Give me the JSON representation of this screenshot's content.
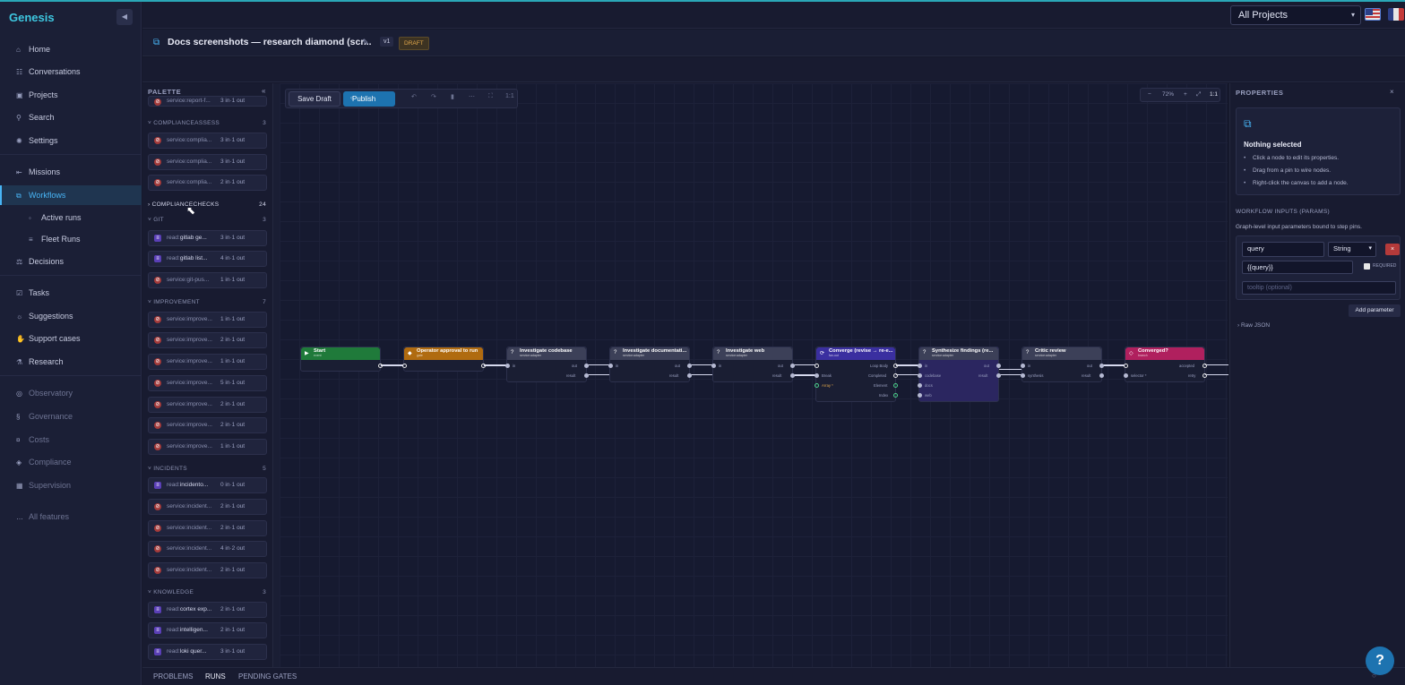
{
  "app": {
    "brand": "Genesis",
    "collapse_icon": "◀"
  },
  "nav": {
    "home": "Home",
    "conversations": "Conversations",
    "projects": "Projects",
    "search": "Search",
    "settings": "Settings",
    "missions": "Missions",
    "workflows": "Workflows",
    "active_runs": "Active runs",
    "fleet_runs": "Fleet Runs",
    "decisions": "Decisions",
    "tasks": "Tasks",
    "suggestions": "Suggestions",
    "support_cases": "Support cases",
    "research": "Research",
    "observatory": "Observatory",
    "governance": "Governance",
    "costs": "Costs",
    "compliance": "Compliance",
    "supervision": "Supervision",
    "all_features": "All features"
  },
  "header": {
    "project_select": "All Projects",
    "doc_title": "Docs screenshots — research diamond (scr...",
    "version": "v1",
    "status": "DRAFT"
  },
  "palette": {
    "title": "PALETTE",
    "close": "«",
    "top_item": {
      "name": "service:report-f...",
      "io": "3 in·1 out"
    },
    "categories": [
      {
        "name": "COMPLIANCEASSESS",
        "count": "3"
      },
      {
        "name": "COMPLIANCECHECKS",
        "count": "24"
      },
      {
        "name": "GIT",
        "count": "3"
      },
      {
        "name": "IMPROVEMENT",
        "count": "7"
      },
      {
        "name": "INCIDENTS",
        "count": "5"
      },
      {
        "name": "KNOWLEDGE",
        "count": "3"
      }
    ],
    "assess_items": [
      {
        "prefix": "service:",
        "name": "complia...",
        "io": "3 in·1 out"
      },
      {
        "prefix": "service:",
        "name": "complia...",
        "io": "3 in·1 out"
      },
      {
        "prefix": "service:",
        "name": "complia...",
        "io": "2 in·1 out"
      }
    ],
    "git_items": [
      {
        "prefix": "read:",
        "name": "gitlab ge...",
        "io": "3 in·1 out"
      },
      {
        "prefix": "read:",
        "name": "gitlab list...",
        "io": "4 in·1 out"
      },
      {
        "prefix": "service:",
        "name": "git-pus...",
        "io": "1 in·1 out"
      }
    ],
    "improvement_items": [
      {
        "prefix": "service:",
        "name": "improve...",
        "io": "1 in·1 out"
      },
      {
        "prefix": "service:",
        "name": "improve...",
        "io": "2 in·1 out"
      },
      {
        "prefix": "service:",
        "name": "improve...",
        "io": "1 in·1 out"
      },
      {
        "prefix": "service:",
        "name": "improve...",
        "io": "5 in·1 out"
      },
      {
        "prefix": "service:",
        "name": "improve...",
        "io": "2 in·1 out"
      },
      {
        "prefix": "service:",
        "name": "improve...",
        "io": "2 in·1 out"
      },
      {
        "prefix": "service:",
        "name": "improve...",
        "io": "1 in·1 out"
      }
    ],
    "incident_items": [
      {
        "prefix": "read:",
        "name": "incidento...",
        "io": "0 in·1 out"
      },
      {
        "prefix": "service:",
        "name": "incident...",
        "io": "2 in·1 out"
      },
      {
        "prefix": "service:",
        "name": "incident...",
        "io": "2 in·1 out"
      },
      {
        "prefix": "service:",
        "name": "incident...",
        "io": "4 in·2 out"
      },
      {
        "prefix": "service:",
        "name": "incident...",
        "io": "2 in·1 out"
      }
    ],
    "knowledge_items": [
      {
        "prefix": "read:",
        "name": "cortex exp...",
        "io": "2 in·1 out"
      },
      {
        "prefix": "read:",
        "name": "intelligen...",
        "io": "2 in·1 out"
      },
      {
        "prefix": "read:",
        "name": "loki quer...",
        "io": "3 in·1 out"
      }
    ]
  },
  "toolbar": {
    "save": "Save Draft",
    "publish": "Publish",
    "fit": "1:1"
  },
  "zoom": {
    "level": "72%",
    "fit": "1:1"
  },
  "nodes": {
    "start": {
      "title": "Start",
      "sub": "event"
    },
    "approval": {
      "title": "Operator approval to run",
      "sub": "gate"
    },
    "codebase": {
      "title": "Investigate codebase",
      "sub": "service:adapter"
    },
    "documentation": {
      "title": "Investigate documentati...",
      "sub": "service:adapter"
    },
    "web": {
      "title": "Investigate web",
      "sub": "service:adapter"
    },
    "converge": {
      "title": "Converge (revise → re-e...",
      "sub": "fan-out"
    },
    "synthesize": {
      "title": "Synthesize findings (re...",
      "sub": "service:adapter"
    },
    "critic": {
      "title": "Critic review",
      "sub": "service:adapter"
    },
    "converged": {
      "title": "Converged?",
      "sub": "branch"
    }
  },
  "pins": {
    "in": "in",
    "out": "out",
    "result": "result",
    "loop_body": "Loop Body",
    "completed": "Completed",
    "element": "Element",
    "index": "Index",
    "break": "Break",
    "array": "Array *",
    "codebase": "codebase",
    "docs": "docs",
    "web": "web",
    "synthesis": "synthesis",
    "selector": "selector *",
    "accepted": "accepted",
    "retry": "retry"
  },
  "properties": {
    "title": "PROPERTIES",
    "close": "×",
    "nothing_selected": "Nothing selected",
    "tips": [
      "Click a node to edit its properties.",
      "Drag from a pin to wire nodes.",
      "Right-click the canvas to add a node."
    ],
    "inputs_header": "WORKFLOW INPUTS (PARAMS)",
    "inputs_sub": "Graph-level input parameters bound to step pins.",
    "param": {
      "name": "query",
      "type": "String",
      "binding": "{{query}}",
      "required": "REQUIRED",
      "tooltip_placeholder": "tooltip (optional)"
    },
    "add_param": "Add parameter",
    "raw_json": "Raw JSON"
  },
  "bottom": {
    "problems": "PROBLEMS",
    "runs": "RUNS",
    "pending_gates": "PENDING GATES"
  },
  "help": "?"
}
